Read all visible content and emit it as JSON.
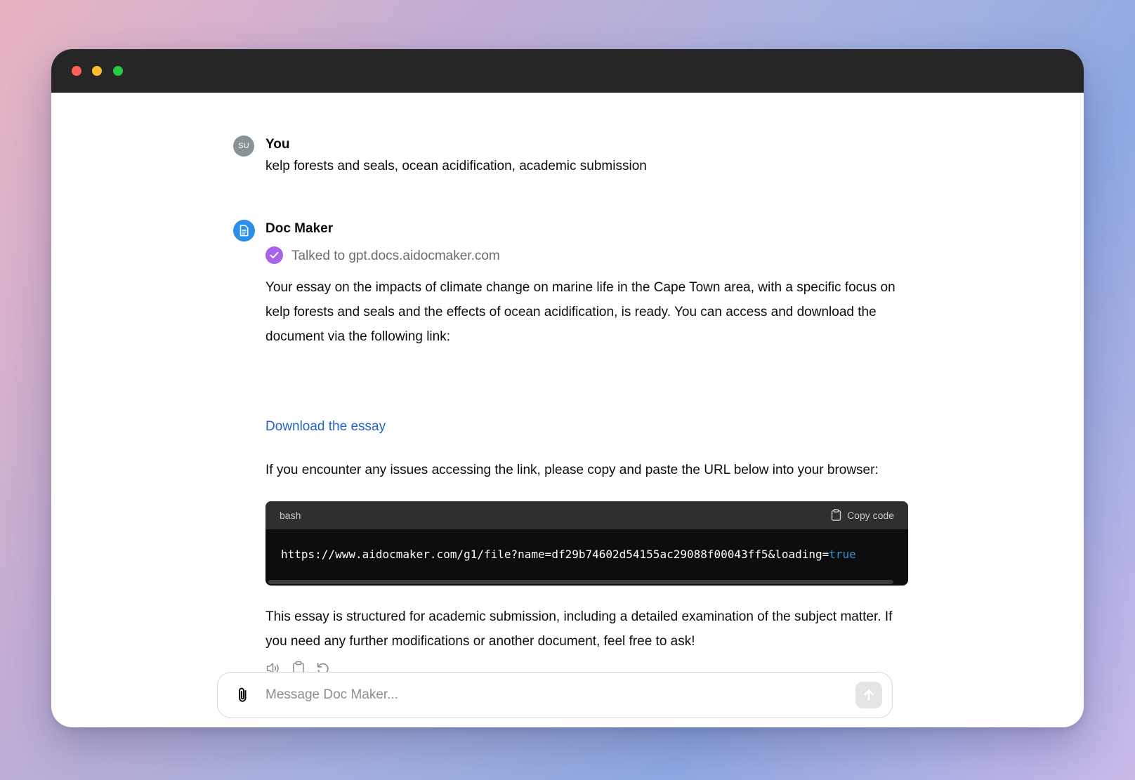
{
  "window": {
    "controls": [
      "close",
      "minimize",
      "maximize"
    ]
  },
  "user_message": {
    "avatar_initials": "SU",
    "sender": "You",
    "text": "kelp forests and seals, ocean acidification, academic submission"
  },
  "assistant_message": {
    "avatar_icon": "document-icon",
    "sender": "Doc Maker",
    "tool_status": "Talked to gpt.docs.aidocmaker.com",
    "paragraph_1": "Your essay on the impacts of climate change on marine life in the Cape Town area, with a specific focus on kelp forests and seals and the effects of ocean acidification, is ready. You can access and download the document via the following link:",
    "link_text": "Download the essay",
    "paragraph_2": "If you encounter any issues accessing the link, please copy and paste the URL below into your browser:",
    "code": {
      "language": "bash",
      "copy_label": "Copy code",
      "line_main": "https://www.aidocmaker.com/g1/file?name=df29b74602d54155ac29088f00043ff5&loading=",
      "line_keyword": "true"
    },
    "paragraph_3": "This essay is structured for academic submission, including a detailed examination of the subject matter. If you need any further modifications or another document, feel free to ask!",
    "actions": [
      "read-aloud-icon",
      "copy-icon",
      "regenerate-icon"
    ]
  },
  "composer": {
    "placeholder": "Message Doc Maker...",
    "value": ""
  },
  "colors": {
    "titlebar": "#262626",
    "link": "#2464c4",
    "bot_avatar": "#2b8fe8",
    "tool_check": "#a863e8",
    "code_bg": "#0d0d0d",
    "code_keyword": "#2e95d3"
  }
}
